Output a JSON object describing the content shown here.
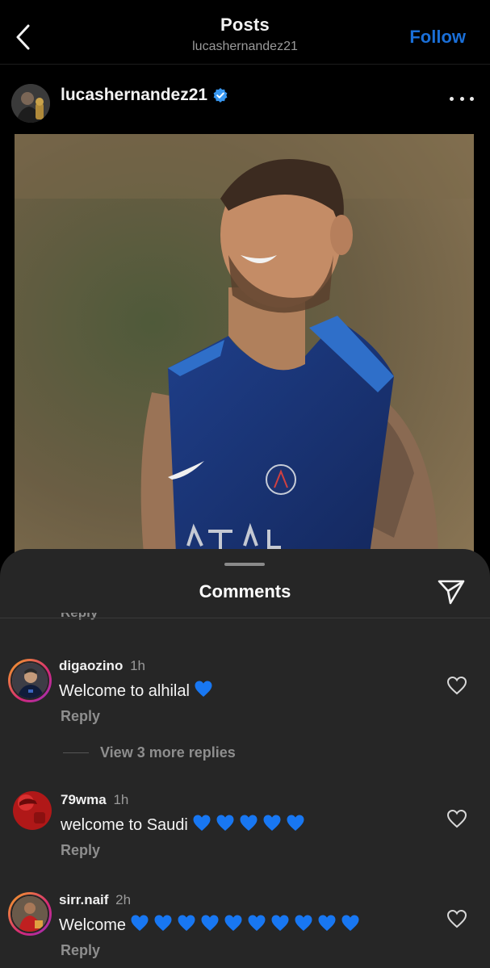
{
  "nav": {
    "title": "Posts",
    "subtitle": "lucashernandez21",
    "follow_label": "Follow"
  },
  "post": {
    "username": "lucashernandez21",
    "verified": true
  },
  "comments_sheet": {
    "title": "Comments",
    "partial_reply_label": "Reply",
    "comments": [
      {
        "username": "digaozino",
        "time": "1h",
        "text": "Welcome to alhilal",
        "hearts": 1,
        "reply_label": "Reply",
        "view_more": "View 3 more replies"
      },
      {
        "username": "79wma",
        "time": "1h",
        "text": "welcome to Saudi",
        "hearts": 5,
        "reply_label": "Reply"
      },
      {
        "username": "sirr.naif",
        "time": "2h",
        "text": "Welcome",
        "hearts": 10,
        "reply_label": "Reply"
      }
    ]
  },
  "colors": {
    "accent": "#1a6fd8",
    "heart_emoji": "#1877f2",
    "sheet_bg": "#262626"
  }
}
